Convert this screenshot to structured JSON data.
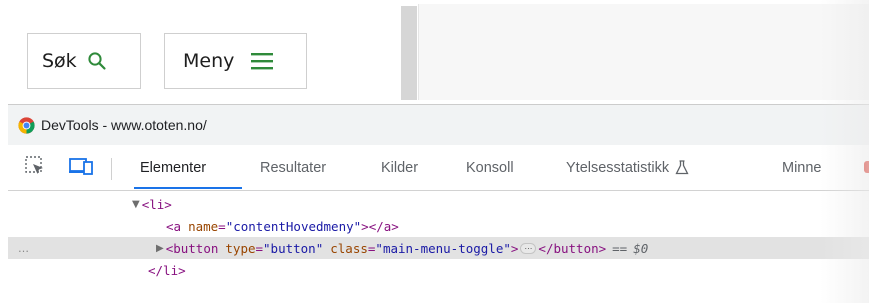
{
  "site": {
    "search_label": "Søk",
    "menu_label": "Meny"
  },
  "devtools": {
    "window_title": "DevTools - www.ototen.no/",
    "tabs": [
      {
        "label": "Elementer",
        "active": true
      },
      {
        "label": "Resultater",
        "active": false
      },
      {
        "label": "Kilder",
        "active": false
      },
      {
        "label": "Konsoll",
        "active": false
      },
      {
        "label": "Ytelsesstatistikk",
        "active": false
      },
      {
        "label": "Minne",
        "active": false
      }
    ],
    "dom": {
      "li_open": "<li>",
      "a_tag_open": "<a",
      "a_attr_name": "name",
      "a_attr_value": "\"contentHovedmeny\"",
      "a_tag_close": "></a>",
      "button_open": "<button",
      "button_attr_type": "type",
      "button_attr_type_value": "\"button\"",
      "button_attr_class": "class",
      "button_attr_class_value": "\"main-menu-toggle\"",
      "button_mid": ">",
      "ellipsis": "⋯",
      "button_close": "</button>",
      "eq": "==",
      "dollar": "$0",
      "li_close": "</li>",
      "dots": "…"
    }
  },
  "colors": {
    "accent": "#1a73e8",
    "green_icon": "#2f8a3a",
    "tag": "#881280",
    "attr_name": "#994500",
    "attr_value": "#1a1aa6",
    "selected_row": "#e2e2e2"
  }
}
